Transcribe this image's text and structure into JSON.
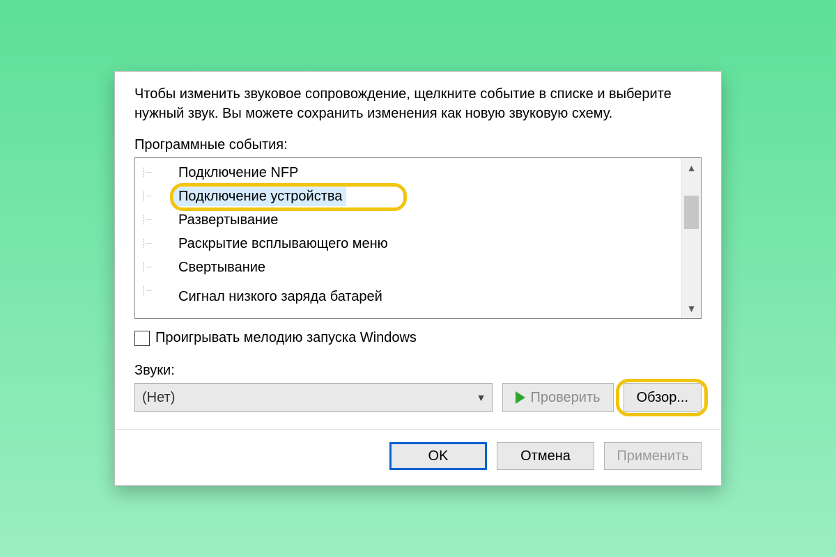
{
  "instruction": "Чтобы изменить звуковое сопровождение, щелкните событие в списке и выберите нужный звук. Вы можете сохранить изменения как новую звуковую схему.",
  "events_label": "Программные события:",
  "events": [
    {
      "text": "Подключение NFP",
      "selected": false
    },
    {
      "text": "Подключение устройства",
      "selected": true
    },
    {
      "text": "Развертывание",
      "selected": false
    },
    {
      "text": "Раскрытие всплывающего меню",
      "selected": false
    },
    {
      "text": "Свертывание",
      "selected": false
    },
    {
      "text": "Сигнал низкого заряда батарей",
      "selected": false
    }
  ],
  "checkbox_label": "Проигрывать мелодию запуска Windows",
  "sounds_label": "Звуки:",
  "combo_value": "(Нет)",
  "test_button": "Проверить",
  "browse_button": "Обзор...",
  "footer": {
    "ok": "OK",
    "cancel": "Отмена",
    "apply": "Применить"
  }
}
